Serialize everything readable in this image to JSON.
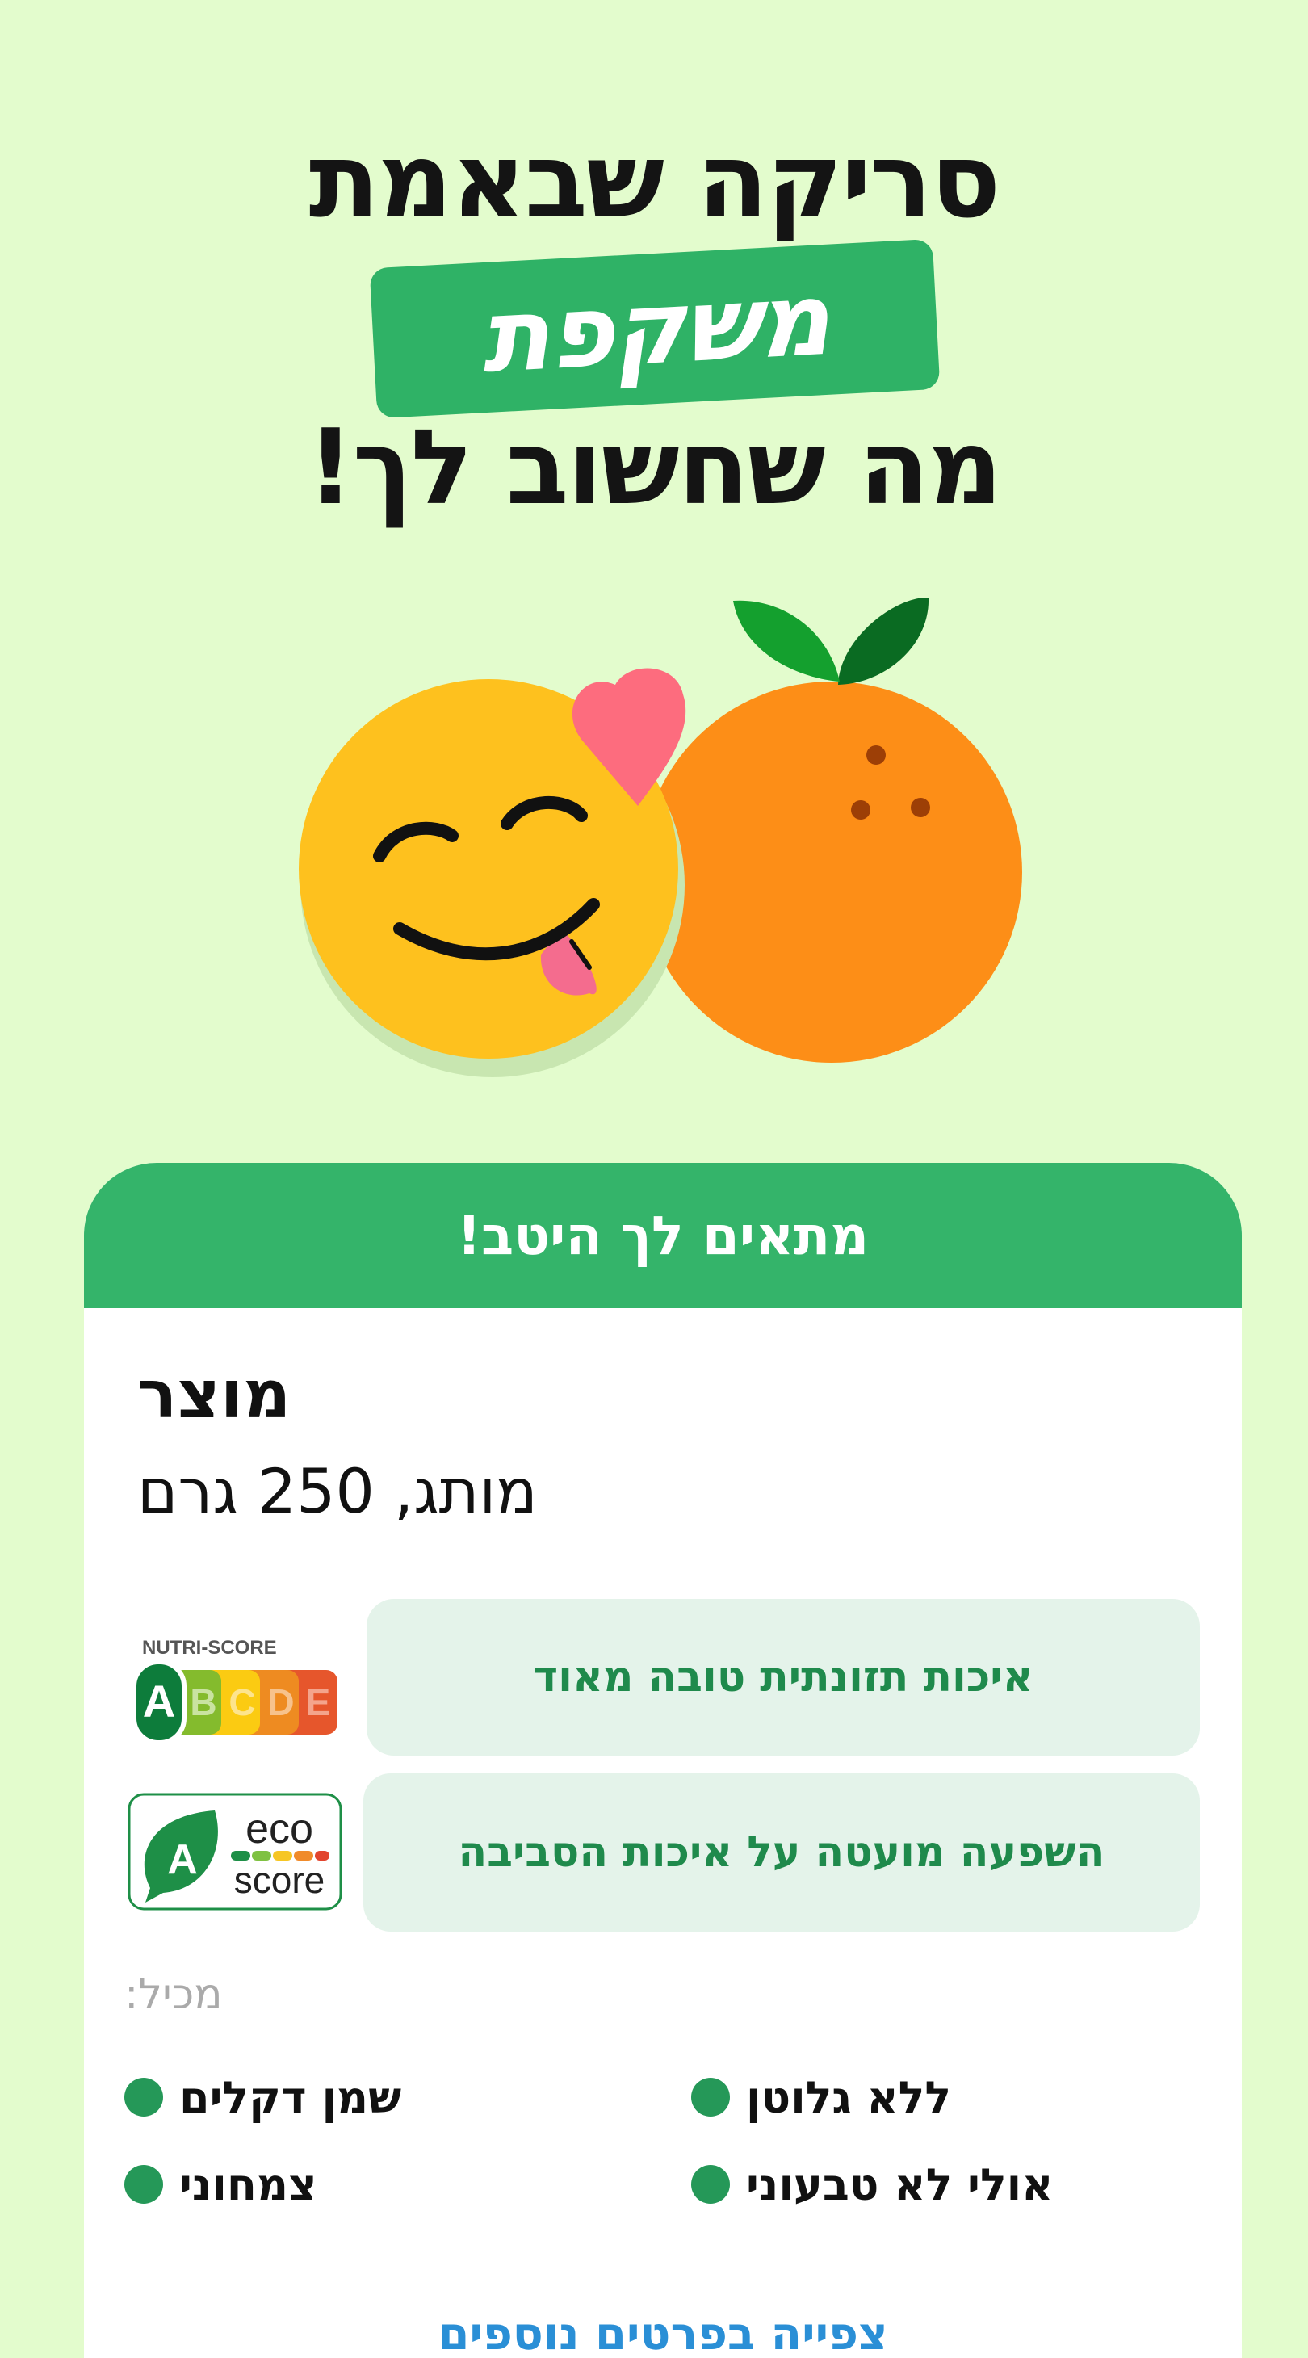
{
  "headline": {
    "line1": "סריקה שבאמת",
    "highlight": "משקפת",
    "line3": "מה שחשוב לך!"
  },
  "card": {
    "header": "מתאים לך היטב!",
    "product_name": "מוצר",
    "product_details": "מותג, 250 גרם",
    "nutri_score": {
      "logo_text": "NUTRI-SCORE",
      "grades": [
        "A",
        "B",
        "C",
        "D",
        "E"
      ],
      "selected": "A",
      "description": "איכות תזונתית טובה מאוד"
    },
    "eco_score": {
      "grade": "A",
      "logo_top": "eco",
      "logo_bottom": "score",
      "description": "השפעה מועטה על איכות הסביבה"
    },
    "contains_label": "מכיל:",
    "tags": [
      "שמן דקלים",
      "ללא גלוטן",
      "צמחוני",
      "אולי לא טבעוני"
    ],
    "more_link": "צפייה בפרטים נוספים"
  },
  "colors": {
    "background": "#e3fccd",
    "accent_green": "#34b46a",
    "text_green": "#1f8a4c",
    "link_blue": "#2a8fd6"
  }
}
